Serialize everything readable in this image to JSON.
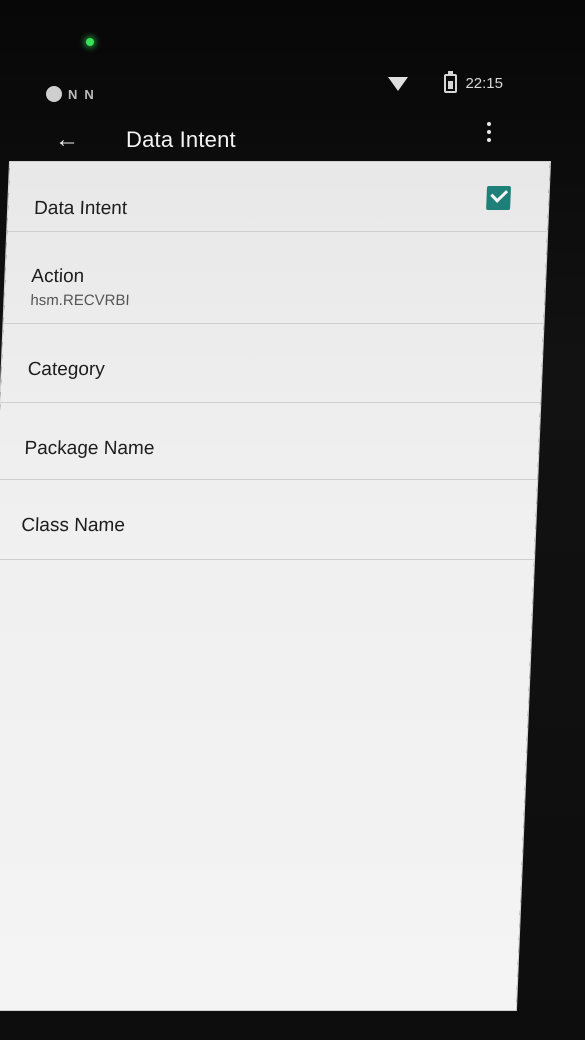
{
  "status_bar": {
    "left_icons": [
      "O",
      "N",
      "N"
    ],
    "time": "22:15"
  },
  "app_bar": {
    "back_icon": "arrow-left",
    "title": "Data Intent",
    "overflow_icon": "vertical-ellipsis"
  },
  "list": {
    "rows": [
      {
        "label": "Data Intent",
        "checked": true
      },
      {
        "label": "Action",
        "value": "hsm.RECVRBI"
      },
      {
        "label": "Category"
      },
      {
        "label": "Package Name"
      },
      {
        "label": "Class Name"
      }
    ]
  },
  "colors": {
    "accent": "#1f7f79",
    "status_led": "#39e25a"
  }
}
